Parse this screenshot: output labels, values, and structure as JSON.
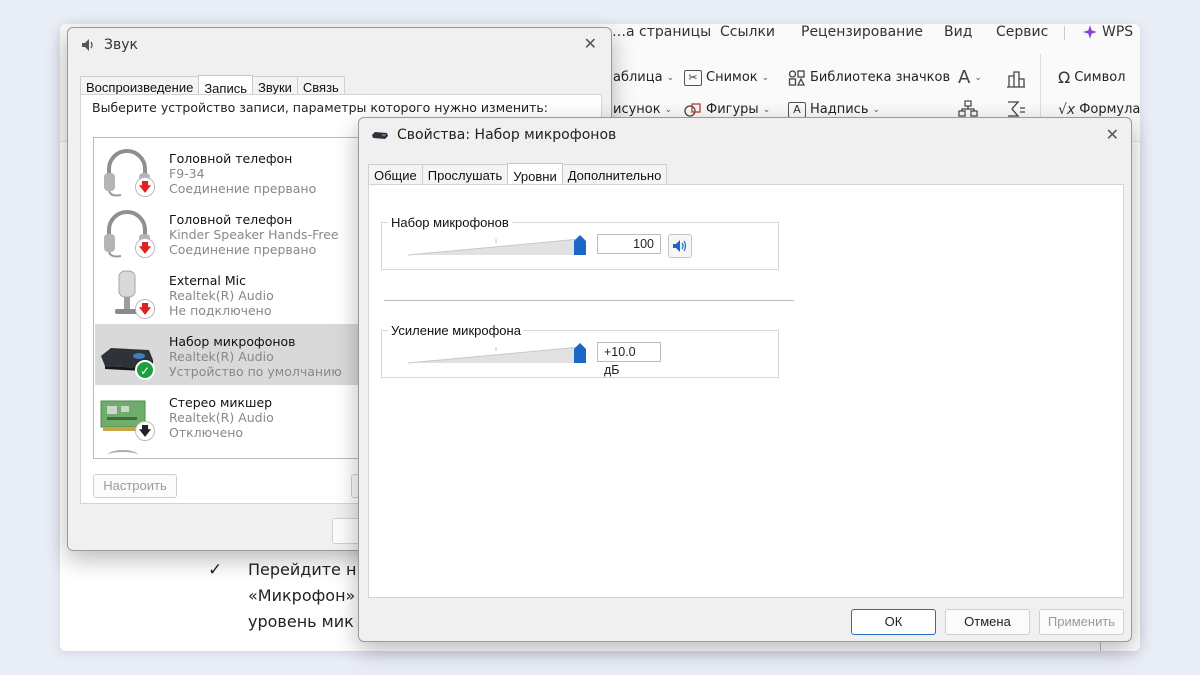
{
  "word": {
    "tabs": [
      "…а страницы",
      "Ссылки",
      "Рецензирование",
      "Вид",
      "Сервис",
      "WPS"
    ],
    "ribbon": {
      "table": "…аблица",
      "snapshot": "Снимок",
      "icon_library": "Библиотека значков",
      "symbol": "Символ",
      "drawing": "…исунок",
      "shapes": "Фигуры",
      "caption": "Надпись",
      "formula": "Формула"
    },
    "doc_lines": [
      "Перейдите н",
      "«Микрофон»",
      "уровень мик"
    ]
  },
  "sound": {
    "title": "Звук",
    "tabs": [
      "Воспроизведение",
      "Запись",
      "Звуки",
      "Связь"
    ],
    "active_tab": "Запись",
    "instruction": "Выберите устройство записи, параметры которого нужно изменить:",
    "devices": [
      {
        "name": "Головной телефон",
        "line1": "F9-34",
        "line2": "Соединение прервано",
        "icon": "headset-icon",
        "status": "disconnected"
      },
      {
        "name": "Головной телефон",
        "line1": "Kinder Speaker Hands-Free",
        "line2": "Соединение прервано",
        "icon": "headset-icon",
        "status": "disconnected"
      },
      {
        "name": "External Mic",
        "line1": "Realtek(R) Audio",
        "line2": "Не подключено",
        "icon": "microphone-icon",
        "status": "unplugged"
      },
      {
        "name": "Набор микрофонов",
        "line1": "Realtek(R) Audio",
        "line2": "Устройство по умолчанию",
        "icon": "mic-array-icon",
        "status": "default"
      },
      {
        "name": "Стерео микшер",
        "line1": "Realtek(R) Audio",
        "line2": "Отключено",
        "icon": "sound-card-icon",
        "status": "disabled"
      }
    ],
    "configure_button": "Настроить"
  },
  "props": {
    "title": "Свойства: Набор микрофонов",
    "tabs": [
      "Общие",
      "Прослушать",
      "Уровни",
      "Дополнительно"
    ],
    "active_tab": "Уровни",
    "level": {
      "label": "Набор микрофонов",
      "value": "100",
      "fraction": 1.0
    },
    "boost": {
      "label": "Усиление микрофона",
      "value": "+10.0 дБ",
      "fraction": 1.0
    },
    "buttons": {
      "ok": "ОК",
      "cancel": "Отмена",
      "apply": "Применить"
    }
  },
  "colors": {
    "accent": "#1a67c8",
    "selected_row": "#d9d9d9",
    "error": "#d22222",
    "success": "#1e9f42"
  }
}
